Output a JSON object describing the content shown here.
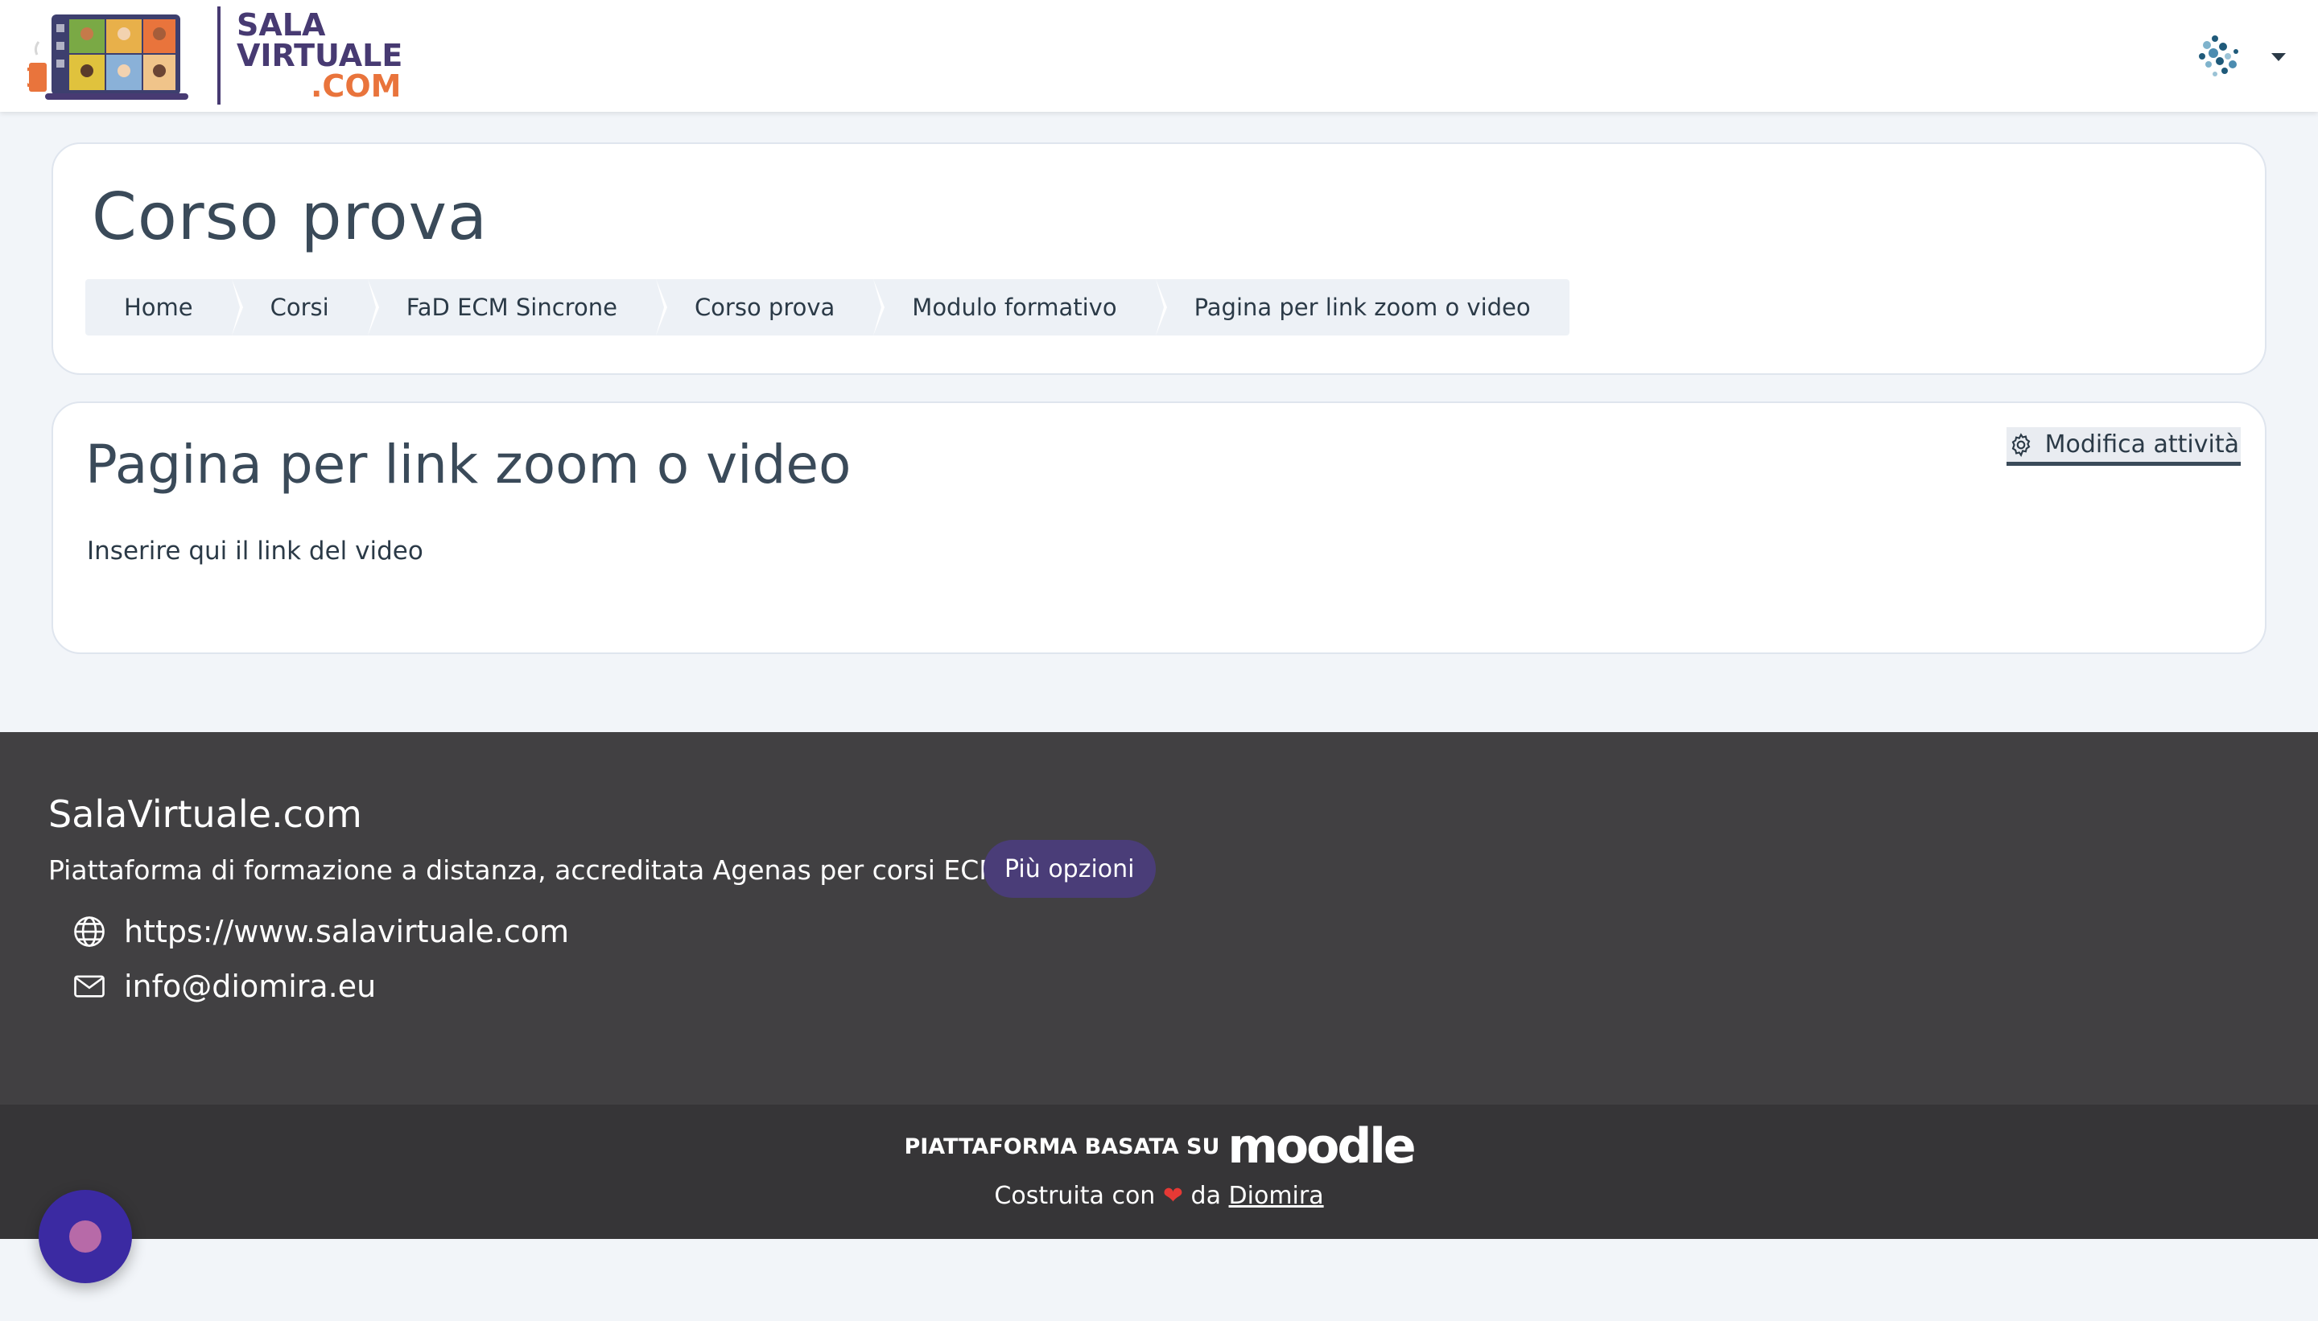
{
  "navbar": {
    "logo_line1": "SALA",
    "logo_line2": "VIRTUALE",
    "logo_line3": ".COM"
  },
  "header": {
    "title": "Corso prova",
    "breadcrumb": [
      "Home",
      "Corsi",
      "FaD ECM Sincrone",
      "Corso prova",
      "Modulo formativo",
      "Pagina per link zoom o video"
    ]
  },
  "activity": {
    "title": "Pagina per link zoom o video",
    "text": "Inserire qui il link del video",
    "edit_label": "Modifica attività"
  },
  "footer": {
    "site_name": "SalaVirtuale.com",
    "description": "Piattaforma di formazione a distanza, accreditata Agenas per corsi ECM",
    "more_options": "Più opzioni",
    "website": "https://www.salavirtuale.com",
    "email": "info@diomira.eu",
    "powered_label": "PIATTAFORMA BASATA SU",
    "moodle": "moodle",
    "built_prefix": "Costruita con",
    "built_middle": "da",
    "built_link": "Diomira"
  },
  "colors": {
    "brand_purple": "#473a72",
    "brand_orange": "#e9743c",
    "footer_bg": "#414042",
    "footer_bottom_bg": "#363537",
    "chat_button": "#3b2aa2"
  },
  "icons": {
    "edit": "gear-icon",
    "website": "globe-icon",
    "email": "envelope-icon",
    "love": "heart-icon"
  }
}
